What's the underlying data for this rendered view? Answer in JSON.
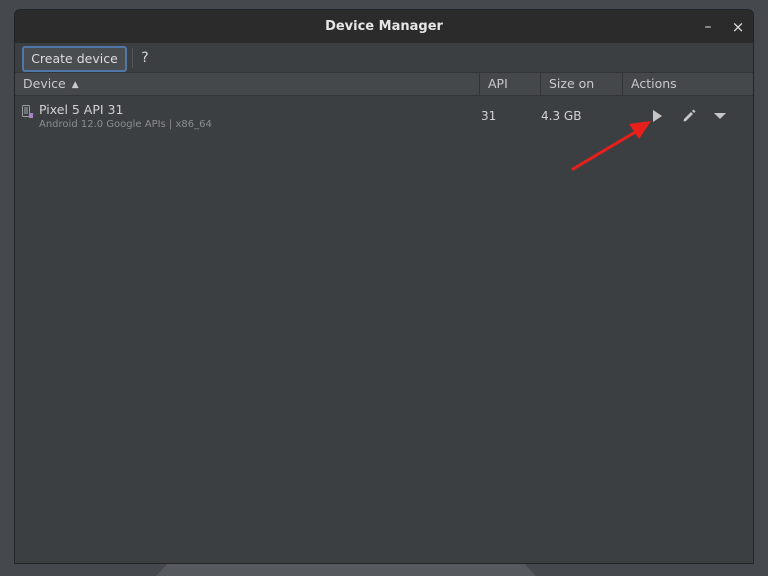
{
  "window": {
    "title": "Device Manager",
    "minimize_label": "–",
    "close_label": "×"
  },
  "toolbar": {
    "create_label": "Create device",
    "help_label": "?"
  },
  "table": {
    "columns": [
      "Device",
      "API",
      "Size on Disk",
      "Actions"
    ],
    "sort_column": "Device",
    "sort_direction": "ascending",
    "rows": [
      {
        "name": "Pixel 5 API 31",
        "subtitle": "Android 12.0 Google APIs | x86_64",
        "api": "31",
        "size": "4.3 GB",
        "actions": [
          "play-icon",
          "pencil-icon",
          "caret-down-icon"
        ]
      }
    ]
  },
  "colors": {
    "window_bg": "#3c3f41",
    "titlebar_bg": "#2b2b2b",
    "header_bg": "#45484a",
    "focus_border": "#4f78a8",
    "annotation_arrow": "#e8201c"
  }
}
